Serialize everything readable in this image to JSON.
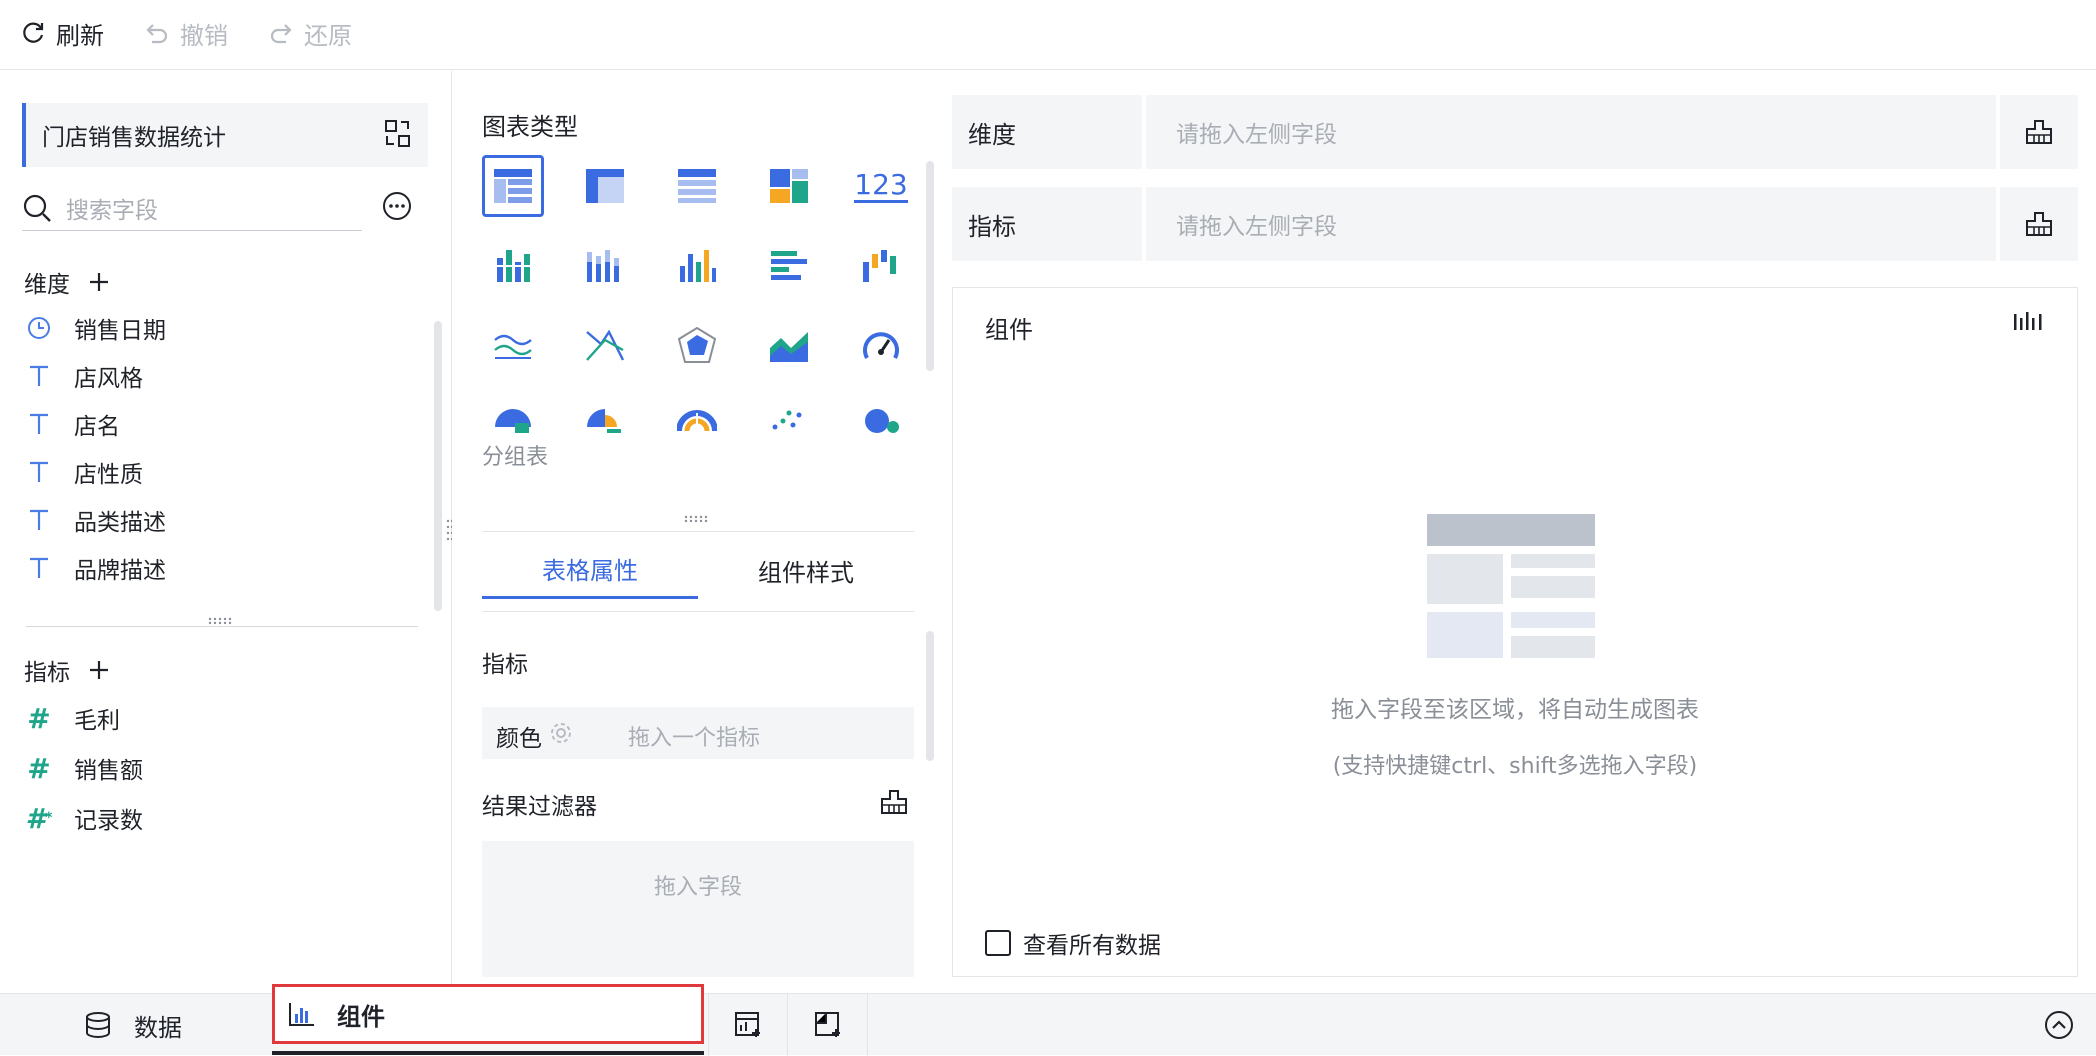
{
  "toolbar": {
    "refresh": "刷新",
    "undo": "撤销",
    "redo": "还原"
  },
  "left": {
    "dataset_name": "门店销售数据统计",
    "search_placeholder": "搜索字段",
    "dimensions_title": "维度",
    "dimensions": [
      {
        "label": "销售日期",
        "icon": "clock-icon"
      },
      {
        "label": "店风格",
        "icon": "text-type-icon"
      },
      {
        "label": "店名",
        "icon": "text-type-icon"
      },
      {
        "label": "店性质",
        "icon": "text-type-icon"
      },
      {
        "label": "品类描述",
        "icon": "text-type-icon"
      },
      {
        "label": "品牌描述",
        "icon": "text-type-icon"
      }
    ],
    "metrics_title": "指标",
    "metrics": [
      {
        "label": "毛利",
        "icon": "number-type-icon"
      },
      {
        "label": "销售额",
        "icon": "number-type-icon"
      },
      {
        "label": "记录数",
        "icon": "record-count-icon"
      }
    ]
  },
  "mid": {
    "chart_types_title": "图表类型",
    "chart_number_glyph": "123",
    "selected_chart_name": "分组表",
    "tabs": [
      "表格属性",
      "组件样式"
    ],
    "metric_section": "指标",
    "color_label": "颜色",
    "color_placeholder": "拖入一个指标",
    "result_filter": "结果过滤器",
    "drop_field": "拖入字段"
  },
  "right": {
    "dimension_label": "维度",
    "dimension_placeholder": "请拖入左侧字段",
    "metric_label": "指标",
    "metric_placeholder": "请拖入左侧字段",
    "component_title": "组件",
    "empty_hint": "拖入字段至该区域，将自动生成图表",
    "empty_sub": "(支持快捷键ctrl、shift多选拖入字段)",
    "view_all": "查看所有数据"
  },
  "bottom": {
    "data_tab": "数据",
    "component_tab": "组件"
  },
  "colors": {
    "accent": "#3b6be0",
    "highlight_box": "#e0383b",
    "teal": "#1ea58a"
  }
}
